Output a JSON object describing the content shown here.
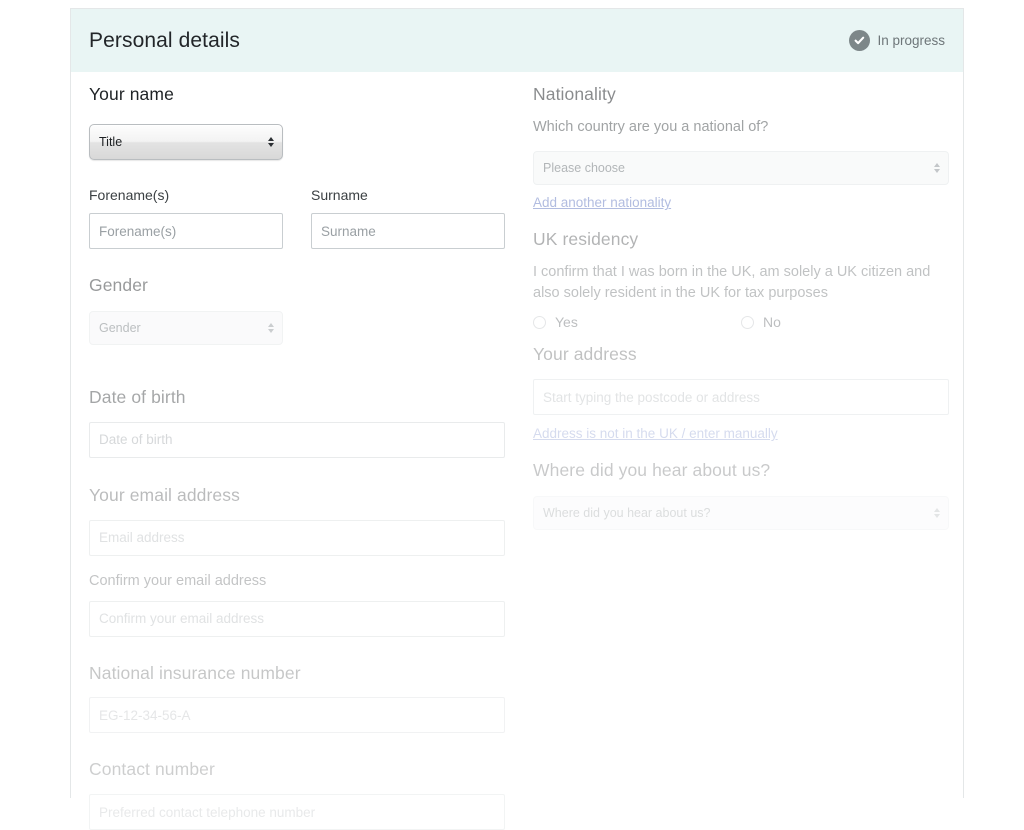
{
  "header": {
    "title": "Personal details",
    "status_label": "In progress",
    "status_icon": "check-circle-icon",
    "background_color": "#e9f5f4",
    "status_icon_color": "#7d8789"
  },
  "left_column": {
    "your_name": {
      "heading": "Your name",
      "title_select": {
        "value": "Title"
      },
      "forename": {
        "label": "Forename(s)",
        "placeholder": "Forename(s)",
        "value": ""
      },
      "surname": {
        "label": "Surname",
        "placeholder": "Surname",
        "value": ""
      }
    },
    "gender": {
      "heading": "Gender",
      "select": {
        "value": "Gender"
      }
    },
    "date_of_birth": {
      "heading": "Date of birth",
      "input": {
        "placeholder": "Date of birth",
        "value": ""
      }
    },
    "email": {
      "heading": "Your email address",
      "input": {
        "placeholder": "Email address",
        "value": ""
      },
      "confirm_label": "Confirm your email address",
      "confirm_input": {
        "placeholder": "Confirm your email address",
        "value": ""
      }
    },
    "national_insurance": {
      "heading": "National insurance number",
      "input": {
        "placeholder": "EG-12-34-56-A",
        "value": ""
      }
    },
    "contact_number": {
      "heading": "Contact number",
      "input": {
        "placeholder": "Preferred contact telephone number",
        "value": ""
      }
    }
  },
  "right_column": {
    "nationality": {
      "heading": "Nationality",
      "question": "Which country are you a national of?",
      "select": {
        "value": "Please choose"
      },
      "add_link": "Add another nationality"
    },
    "uk_residency": {
      "heading": "UK residency",
      "statement": "I confirm that I was born in the UK, am solely a UK citizen and also solely resident in the UK for tax purposes",
      "options": [
        {
          "label": "Yes",
          "selected": false
        },
        {
          "label": "No",
          "selected": false
        }
      ]
    },
    "address": {
      "heading": "Your address",
      "input": {
        "placeholder": "Start typing the postcode or address",
        "value": ""
      },
      "manual_link": "Address is not in the UK / enter manually"
    },
    "hear_about_us": {
      "heading": "Where did you hear about us?",
      "select": {
        "value": "Where did you hear about us?"
      }
    }
  },
  "colors": {
    "link": "#6b7fc4",
    "header_bg": "#e9f5f4",
    "card_border": "#e4e7e8",
    "text_primary": "#1f2326"
  }
}
